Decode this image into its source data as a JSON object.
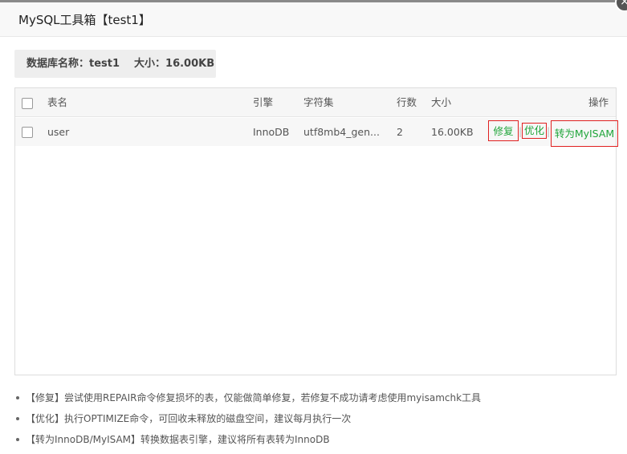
{
  "dialog": {
    "title": "MySQL工具箱【test1】",
    "close_symbol": "×"
  },
  "info": {
    "db_name_label": "数据库名称：test1",
    "size_label": "大小：16.00KB"
  },
  "table": {
    "headers": {
      "name": "表名",
      "engine": "引擎",
      "charset": "字符集",
      "rows": "行数",
      "size": "大小",
      "ops": "操作"
    },
    "rows": [
      {
        "name": "user",
        "engine": "InnoDB",
        "charset": "utf8mb4_gen...",
        "rows": "2",
        "size": "16.00KB",
        "op_repair": "修复",
        "op_optimize": "优化",
        "op_convert": "转为MyISAM"
      }
    ],
    "separator": "|"
  },
  "notes": [
    "【修复】尝试使用REPAIR命令修复损坏的表，仅能做简单修复，若修复不成功请考虑使用myisamchk工具",
    "【优化】执行OPTIMIZE命令，可回收未释放的磁盘空间，建议每月执行一次",
    "【转为InnoDB/MyISAM】转换数据表引擎，建议将所有表转为InnoDB"
  ],
  "colors": {
    "op_link": "#20a53a",
    "highlight_border": "#e02020",
    "info_bg": "#eeeeee"
  }
}
